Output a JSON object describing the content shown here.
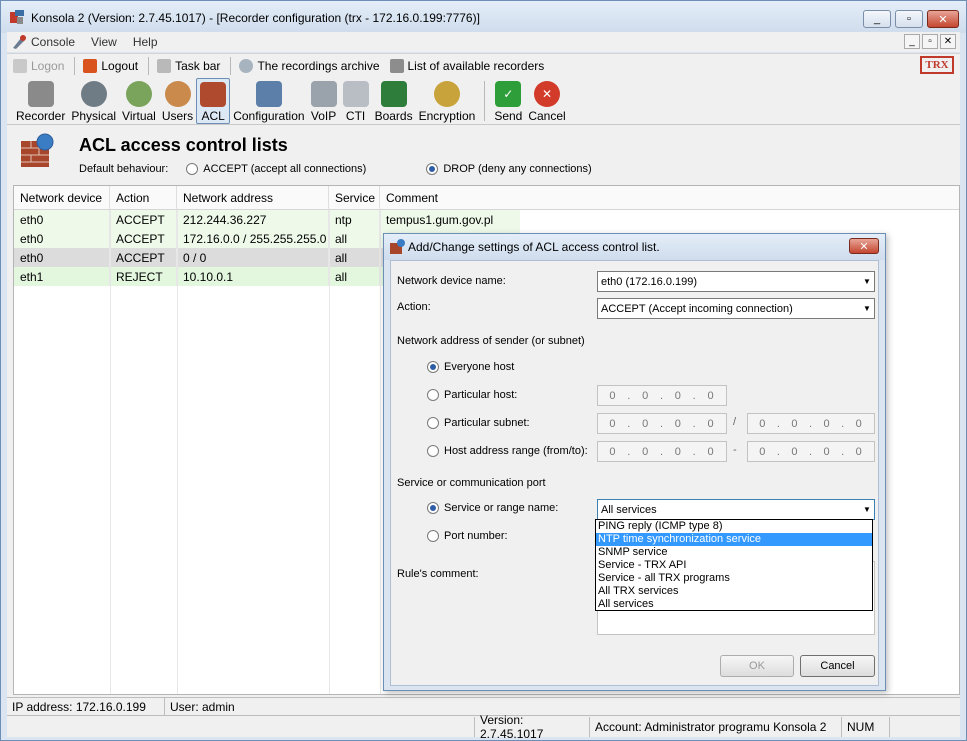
{
  "window": {
    "title": "Konsola 2 (Version:  2.7.45.1017) - [Recorder configuration (trx - 172.16.0.199:7776)]",
    "buttons": [
      "_",
      "▫",
      "✕"
    ]
  },
  "menu": {
    "items": [
      "Console",
      "View",
      "Help"
    ],
    "mdi_buttons": [
      "_",
      "▫",
      "✕"
    ]
  },
  "linkbar": {
    "items": [
      {
        "label": "Logon",
        "icon": "key-icon",
        "enabled": false
      },
      {
        "label": "Logout",
        "icon": "power-icon",
        "enabled": true
      },
      {
        "label": "Task bar",
        "icon": "paperclip-icon",
        "enabled": true
      },
      {
        "label": "The recordings archive",
        "icon": "disc-icon",
        "enabled": true
      },
      {
        "label": "List of available recorders",
        "icon": "tag-icon",
        "enabled": true
      }
    ],
    "logo": "TRX"
  },
  "toolbar": {
    "items": [
      {
        "label": "Recorder",
        "icon": "recorder-icon",
        "color": "#8a8a8a"
      },
      {
        "label": "Physical",
        "icon": "speaker-icon",
        "color": "#6f7c86"
      },
      {
        "label": "Virtual",
        "icon": "speaker-green-icon",
        "color": "#7aa35c"
      },
      {
        "label": "Users",
        "icon": "users-icon",
        "color": "#c98a4c"
      },
      {
        "label": "ACL",
        "icon": "firewall-icon",
        "color": "#b04a2e",
        "active": true
      },
      {
        "label": "Configuration",
        "icon": "configuration-icon",
        "color": "#5b7fa8"
      },
      {
        "label": "VoIP",
        "icon": "voip-phone-icon",
        "color": "#9aa3ab"
      },
      {
        "label": "CTI",
        "icon": "cti-icon",
        "color": "#b8bec4"
      },
      {
        "label": "Boards",
        "icon": "board-icon",
        "color": "#2e7d3a"
      },
      {
        "label": "Encryption",
        "icon": "keys-icon",
        "color": "#c8a23a"
      },
      {
        "label": "Send",
        "icon": "check-icon",
        "color": "#2e9e3a"
      },
      {
        "label": "Cancel",
        "icon": "cancel-icon",
        "color": "#d23a2a"
      }
    ]
  },
  "acl": {
    "title": "ACL access control lists",
    "default_label": "Default behaviour:",
    "options": [
      {
        "label": "ACCEPT (accept all connections)",
        "checked": false
      },
      {
        "label": "DROP (deny any connections)",
        "checked": true
      }
    ]
  },
  "grid": {
    "columns": [
      "Network device",
      "Action",
      "Network address",
      "Service",
      "Comment"
    ],
    "rows": [
      {
        "device": "eth0",
        "action": "ACCEPT",
        "address": "212.244.36.227",
        "service": "ntp",
        "comment": "tempus1.gum.gov.pl",
        "style": "accept"
      },
      {
        "device": "eth0",
        "action": "ACCEPT",
        "address": "172.16.0.0 / 255.255.255.0",
        "service": "all",
        "comment": "",
        "style": "accept"
      },
      {
        "device": "eth0",
        "action": "ACCEPT",
        "address": "0 / 0",
        "service": "all",
        "comment": "",
        "style": "selected"
      },
      {
        "device": "eth1",
        "action": "REJECT",
        "address": "10.10.0.1",
        "service": "all",
        "comment": "",
        "style": "reject"
      }
    ]
  },
  "status": {
    "ip": "IP address: 172.16.0.199",
    "user": "User: admin",
    "version": "Version: 2.7.45.1017",
    "account": "Account: Administrator programu Konsola 2",
    "num": "NUM"
  },
  "dialog": {
    "title": "Add/Change settings of ACL access control list.",
    "close": "✕",
    "device_label": "Network device name:",
    "device_value": "eth0 (172.16.0.199)",
    "action_label": "Action:",
    "action_value": "ACCEPT (Accept incoming connection)",
    "sender_label": "Network address of sender (or subnet)",
    "radios": [
      {
        "label": "Everyone host",
        "checked": true
      },
      {
        "label": "Particular host:",
        "checked": false
      },
      {
        "label": "Particular subnet:",
        "checked": false
      },
      {
        "label": "Host address range (from/to):",
        "checked": false
      }
    ],
    "ip_placeholder": [
      "0",
      "0",
      "0",
      "0"
    ],
    "subnet_sep": "/",
    "range_sep": "-",
    "service_section": "Service or communication port",
    "service_radio": "Service or range name:",
    "service_value": "All services",
    "port_radio": "Port number:",
    "comment_label": "Rule's comment:",
    "service_options": [
      "PING reply (ICMP type 8)",
      "NTP time synchronization service",
      "SNMP service",
      "Service - TRX API",
      "Service - all TRX programs",
      "All TRX services",
      "All services"
    ],
    "highlighted_option": 1,
    "ok": "OK",
    "cancel": "Cancel"
  }
}
